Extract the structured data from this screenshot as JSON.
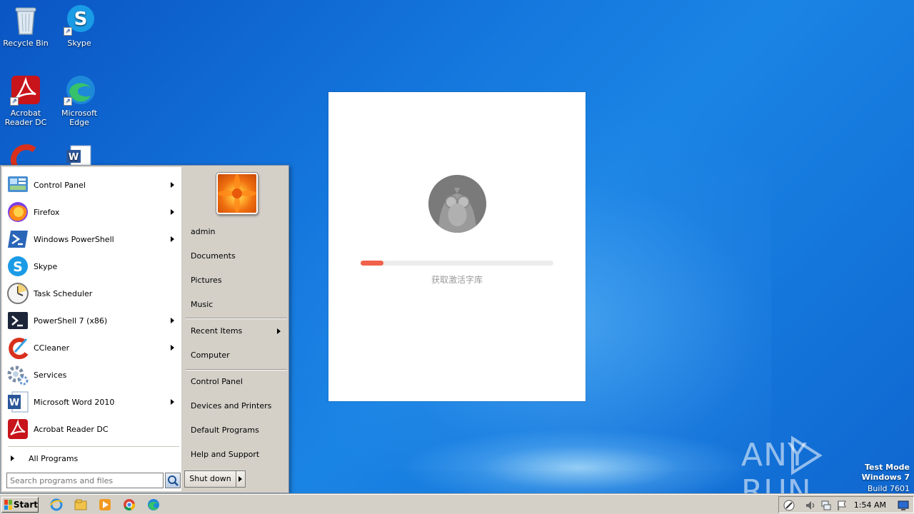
{
  "desktop": {
    "icons": [
      {
        "label": "Recycle Bin"
      },
      {
        "label": "Skype"
      },
      {
        "label": "Acrobat Reader DC"
      },
      {
        "label": "Microsoft Edge"
      }
    ]
  },
  "start_menu": {
    "programs": [
      {
        "label": "Control Panel",
        "submenu": true,
        "icon": "control-panel-icon"
      },
      {
        "label": "Firefox",
        "submenu": true,
        "icon": "firefox-icon"
      },
      {
        "label": "Windows PowerShell",
        "submenu": true,
        "icon": "powershell-icon"
      },
      {
        "label": "Skype",
        "submenu": false,
        "icon": "skype-icon"
      },
      {
        "label": "Task Scheduler",
        "submenu": false,
        "icon": "task-scheduler-icon"
      },
      {
        "label": "PowerShell 7 (x86)",
        "submenu": true,
        "icon": "powershell7-icon"
      },
      {
        "label": "CCleaner",
        "submenu": true,
        "icon": "ccleaner-icon"
      },
      {
        "label": "Services",
        "submenu": false,
        "icon": "services-icon"
      },
      {
        "label": "Microsoft Word 2010",
        "submenu": true,
        "icon": "word-icon"
      },
      {
        "label": "Acrobat Reader DC",
        "submenu": false,
        "icon": "acrobat-icon"
      }
    ],
    "all_programs": "All Programs",
    "search_placeholder": "Search programs and files",
    "right": {
      "user": "admin",
      "documents": "Documents",
      "pictures": "Pictures",
      "music": "Music",
      "recent_items": "Recent Items",
      "computer": "Computer",
      "control_panel": "Control Panel",
      "devices_printers": "Devices and Printers",
      "default_programs": "Default Programs",
      "help_support": "Help and Support"
    },
    "shutdown_label": "Shut down"
  },
  "dialog": {
    "status_text": "获取激活字库",
    "progress": 0.12,
    "accent_color": "#f0604a"
  },
  "watermark": {
    "brand": "ANY RUN",
    "test_mode": "Test Mode",
    "os": "Windows 7",
    "build": "Build 7601"
  },
  "taskbar": {
    "start_label": "Start",
    "clock": "1:54 AM"
  }
}
